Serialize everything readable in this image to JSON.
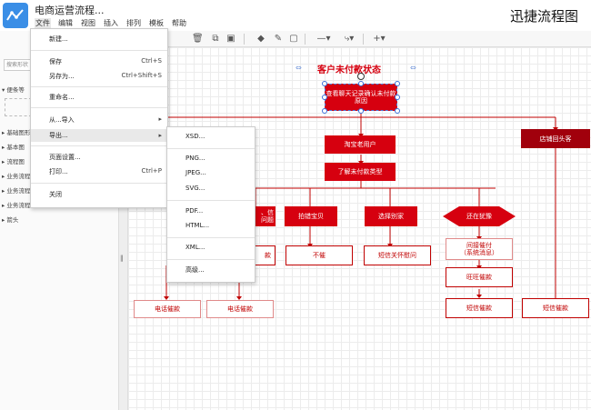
{
  "app": {
    "doc_title": "电商运营流程...",
    "brand": "迅捷流程图"
  },
  "menubar": [
    "文件",
    "编辑",
    "视图",
    "插入",
    "排列",
    "模板",
    "帮助"
  ],
  "sidebar": {
    "search_placeholder": "搜索形状",
    "categories": [
      "便条等",
      "基础图形",
      "基本图",
      "流程图",
      "业务流程",
      "业务流程",
      "业务流程 平衡",
      "箭头"
    ]
  },
  "file_menu": {
    "items": [
      {
        "label": "新建...",
        "shortcut": ""
      },
      {
        "label": "保存",
        "shortcut": "Ctrl+S"
      },
      {
        "label": "另存为...",
        "shortcut": "Ctrl+Shift+S"
      },
      {
        "label": "重命名...",
        "shortcut": ""
      },
      {
        "label": "从...导入",
        "shortcut": "",
        "submenu": true
      },
      {
        "label": "导出...",
        "shortcut": "",
        "submenu": true
      },
      {
        "label": "页面设置...",
        "shortcut": ""
      },
      {
        "label": "打印...",
        "shortcut": "Ctrl+P"
      },
      {
        "label": "关闭",
        "shortcut": ""
      }
    ]
  },
  "export_menu": {
    "items": [
      "XSD...",
      "PNG...",
      "JPEG...",
      "SVG...",
      "PDF...",
      "HTML...",
      "XML...",
      "高级..."
    ]
  },
  "flowchart": {
    "title": "客户未付款状态",
    "nodes": {
      "check_chat": "查看聊天记录确认未付款原因",
      "taobao_user": "淘宝老用户",
      "understand_type": "了解未付款类型",
      "store_return": "店铺回头客",
      "partial_left": "、信\n问题",
      "shot_gems": "拍错宝贝",
      "choose_other": "选择别家",
      "hesitating": "还在犹豫",
      "left_result": "款",
      "no_urge": "不催",
      "sms_care": "短信关怀慰问",
      "direct_urge": "间接催付\n（系统消息）",
      "wangwang_urge": "旺旺催款",
      "sms_urge_mid": "短信催款",
      "sms_urge_right": "短信催款",
      "phone_urge_1": "电话催款",
      "phone_urge_2": "电话催款"
    }
  },
  "colors": {
    "accent_red": "#d6000f",
    "dark_red": "#a1000c",
    "app_blue": "#3a8ee6"
  }
}
